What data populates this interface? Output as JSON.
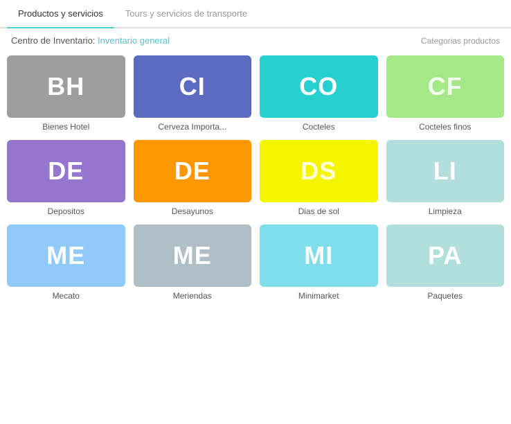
{
  "tabs": [
    {
      "id": "products",
      "label": "Productos y servicios",
      "active": true
    },
    {
      "id": "tours",
      "label": "Tours y servicios de transporte",
      "active": false
    }
  ],
  "header": {
    "inventory_label": "Centro de Inventario:",
    "inventory_link": "Inventario general",
    "categories_label": "Categorias productos"
  },
  "cards": [
    {
      "abbr": "BH",
      "label": "Bienes Hotel",
      "color": "#9e9e9e"
    },
    {
      "abbr": "CI",
      "label": "Cerveza Importa...",
      "color": "#5c6bc0"
    },
    {
      "abbr": "CO",
      "label": "Cocteles",
      "color": "#26d0ce"
    },
    {
      "abbr": "CF",
      "label": "Cocteles finos",
      "color": "#a5e887"
    },
    {
      "abbr": "DE",
      "label": "Depositos",
      "color": "#9575cd"
    },
    {
      "abbr": "DE",
      "label": "Desayunos",
      "color": "#ff9800"
    },
    {
      "abbr": "DS",
      "label": "Dias de sol",
      "color": "#f5f500"
    },
    {
      "abbr": "LI",
      "label": "Limpieza",
      "color": "#b2dfdb"
    },
    {
      "abbr": "ME",
      "label": "Mecato",
      "color": "#90caf9"
    },
    {
      "abbr": "ME",
      "label": "Meriendas",
      "color": "#b0bec5"
    },
    {
      "abbr": "MI",
      "label": "Minimarket",
      "color": "#80deea"
    },
    {
      "abbr": "PA",
      "label": "Paquetes",
      "color": "#b2dfdb"
    }
  ]
}
